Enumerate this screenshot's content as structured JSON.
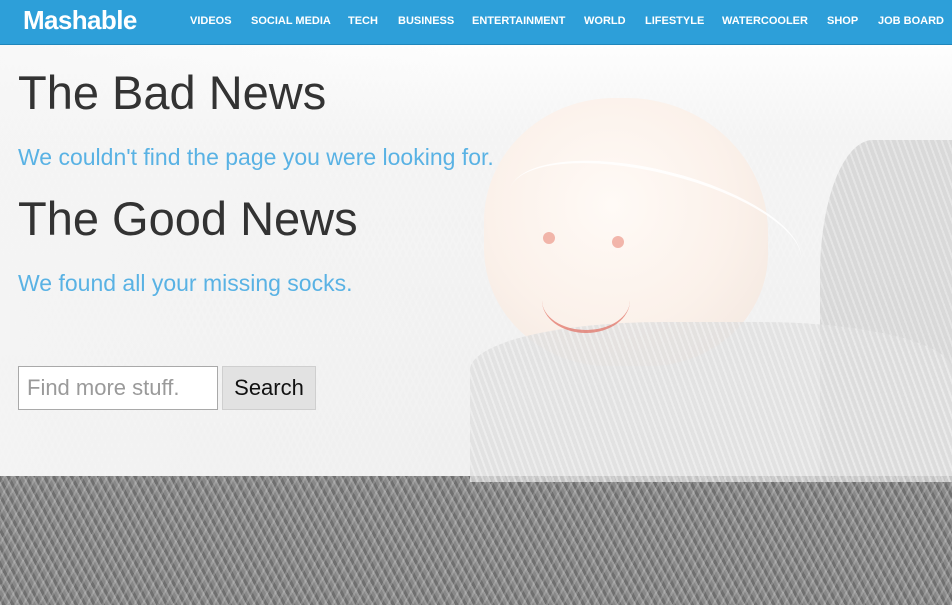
{
  "header": {
    "logo": "Mashable",
    "nav": [
      {
        "label": "VIDEOS"
      },
      {
        "label": "SOCIAL MEDIA"
      },
      {
        "label": "TECH"
      },
      {
        "label": "BUSINESS"
      },
      {
        "label": "ENTERTAINMENT"
      },
      {
        "label": "WORLD"
      },
      {
        "label": "LIFESTYLE"
      },
      {
        "label": "WATERCOOLER"
      },
      {
        "label": "SHOP"
      },
      {
        "label": "JOB BOARD"
      }
    ]
  },
  "main": {
    "bad_title": "The Bad News",
    "bad_message": "We couldn't find the page you were looking for.",
    "good_title": "The Good News",
    "good_message": "We found all your missing socks."
  },
  "search": {
    "placeholder": "Find more stuff.",
    "value": "",
    "button_label": "Search"
  },
  "colors": {
    "header_bg": "#2d9fd9",
    "heading_text": "#333333",
    "message_text": "#59b2e4"
  },
  "background": {
    "illustration": "smiling-sock-photo"
  }
}
